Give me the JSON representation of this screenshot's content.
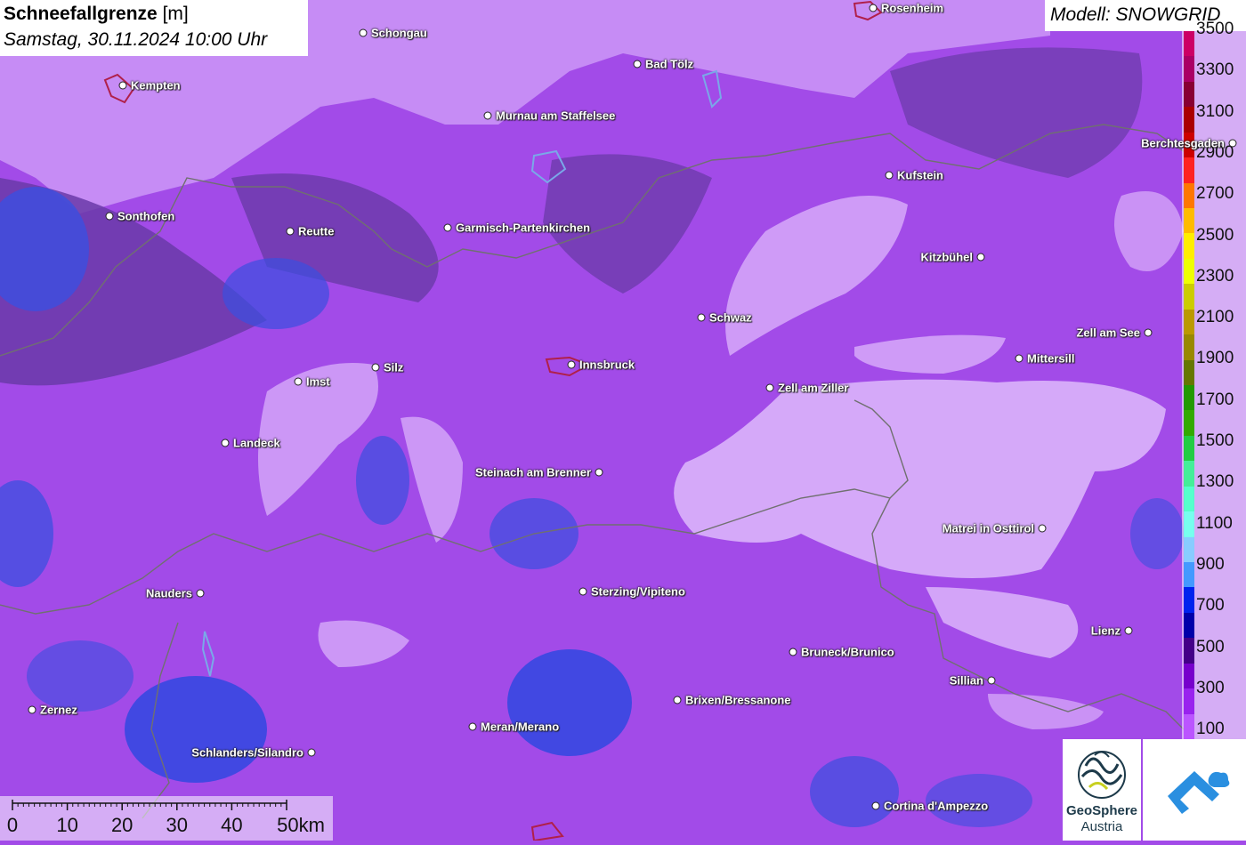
{
  "header": {
    "title_bold": "Schneefallgrenze",
    "title_unit": "[m]",
    "subtitle": "Samstag, 30.11.2024 10:00 Uhr",
    "model": "Modell: SNOWGRID"
  },
  "legend": {
    "labels": [
      "3500",
      "3300",
      "3100",
      "2900",
      "2700",
      "2500",
      "2300",
      "2100",
      "1900",
      "1700",
      "1500",
      "1300",
      "1100",
      "900",
      "700",
      "500",
      "300",
      "100"
    ],
    "colors": [
      "#cc0066",
      "#aa0066",
      "#880033",
      "#aa0000",
      "#cc0000",
      "#ff2222",
      "#ff7700",
      "#ffbb00",
      "#ffee00",
      "#eeff00",
      "#cccc00",
      "#bb9900",
      "#998800",
      "#667700",
      "#229900",
      "#33aa00",
      "#22cc44",
      "#44ee99",
      "#55ffcc",
      "#77ffee",
      "#88ccff",
      "#4499ff",
      "#0022ee",
      "#0000aa",
      "#440088",
      "#7700cc",
      "#9922ee",
      "#bb55ff"
    ]
  },
  "cities": [
    {
      "name": "Rosenheim",
      "dot_side": "left"
    },
    {
      "name": "Schongau",
      "dot_side": "left"
    },
    {
      "name": "Kempten",
      "dot_side": "left"
    },
    {
      "name": "Bad Tölz",
      "dot_side": "left"
    },
    {
      "name": "Murnau am Staffelsee",
      "dot_side": "left"
    },
    {
      "name": "Berchtesgaden",
      "dot_side": "right"
    },
    {
      "name": "Kufstein",
      "dot_side": "left"
    },
    {
      "name": "Sonthofen",
      "dot_side": "left"
    },
    {
      "name": "Reutte",
      "dot_side": "left"
    },
    {
      "name": "Garmisch-Partenkirchen",
      "dot_side": "left"
    },
    {
      "name": "Kitzbühel",
      "dot_side": "right"
    },
    {
      "name": "Schwaz",
      "dot_side": "left"
    },
    {
      "name": "Zell am See",
      "dot_side": "right"
    },
    {
      "name": "Mittersill",
      "dot_side": "left"
    },
    {
      "name": "Innsbruck",
      "dot_side": "left"
    },
    {
      "name": "Silz",
      "dot_side": "left"
    },
    {
      "name": "Imst",
      "dot_side": "left"
    },
    {
      "name": "Zell am Ziller",
      "dot_side": "left"
    },
    {
      "name": "Landeck",
      "dot_side": "left"
    },
    {
      "name": "Steinach am Brenner",
      "dot_side": "right"
    },
    {
      "name": "Matrei in Osttirol",
      "dot_side": "right"
    },
    {
      "name": "Nauders",
      "dot_side": "right"
    },
    {
      "name": "Sterzing/Vipiteno",
      "dot_side": "left"
    },
    {
      "name": "Lienz",
      "dot_side": "right"
    },
    {
      "name": "Bruneck/Brunico",
      "dot_side": "left"
    },
    {
      "name": "Sillian",
      "dot_side": "right"
    },
    {
      "name": "Brixen/Bressanone",
      "dot_side": "left"
    },
    {
      "name": "Zernez",
      "dot_side": "left"
    },
    {
      "name": "Meran/Merano",
      "dot_side": "left"
    },
    {
      "name": "Schlanders/Silandro",
      "dot_side": "right"
    },
    {
      "name": "Cortina d'Ampezzo",
      "dot_side": "left"
    }
  ],
  "scale": {
    "labels": [
      "0",
      "10",
      "20",
      "30",
      "40",
      "50km"
    ]
  },
  "logos": {
    "geosphere_line1": "GeoSphere",
    "geosphere_line2": "Austria"
  }
}
